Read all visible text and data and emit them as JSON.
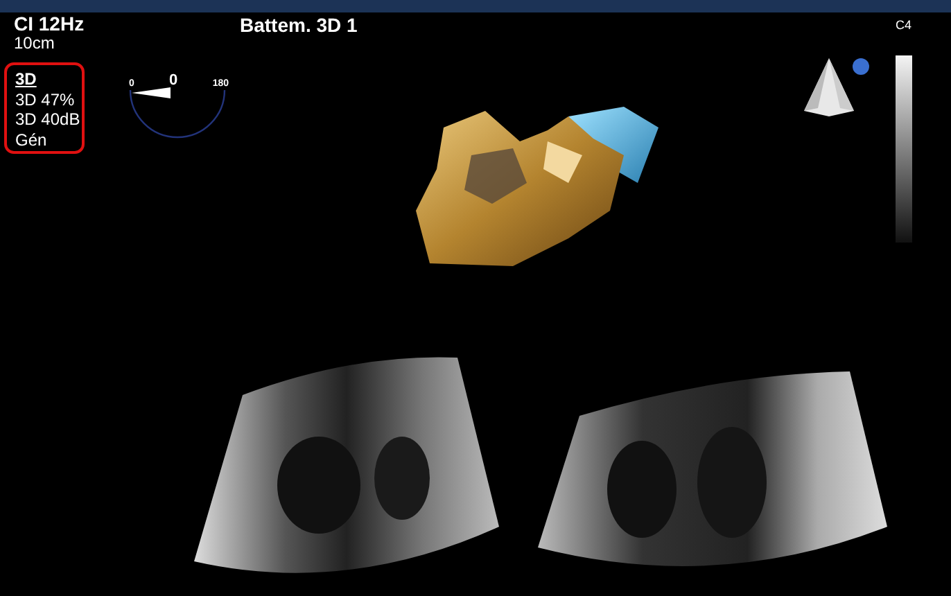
{
  "header": {
    "rate": "CI 12Hz",
    "depth": "10cm",
    "title": "Battem. 3D 1"
  },
  "settings": {
    "heading": "3D",
    "lines": [
      "3D 47%",
      "3D 40dB",
      "Gén"
    ]
  },
  "angle": {
    "min": "0",
    "value": "0",
    "max": "180"
  },
  "grayscale": {
    "label": "C4"
  }
}
